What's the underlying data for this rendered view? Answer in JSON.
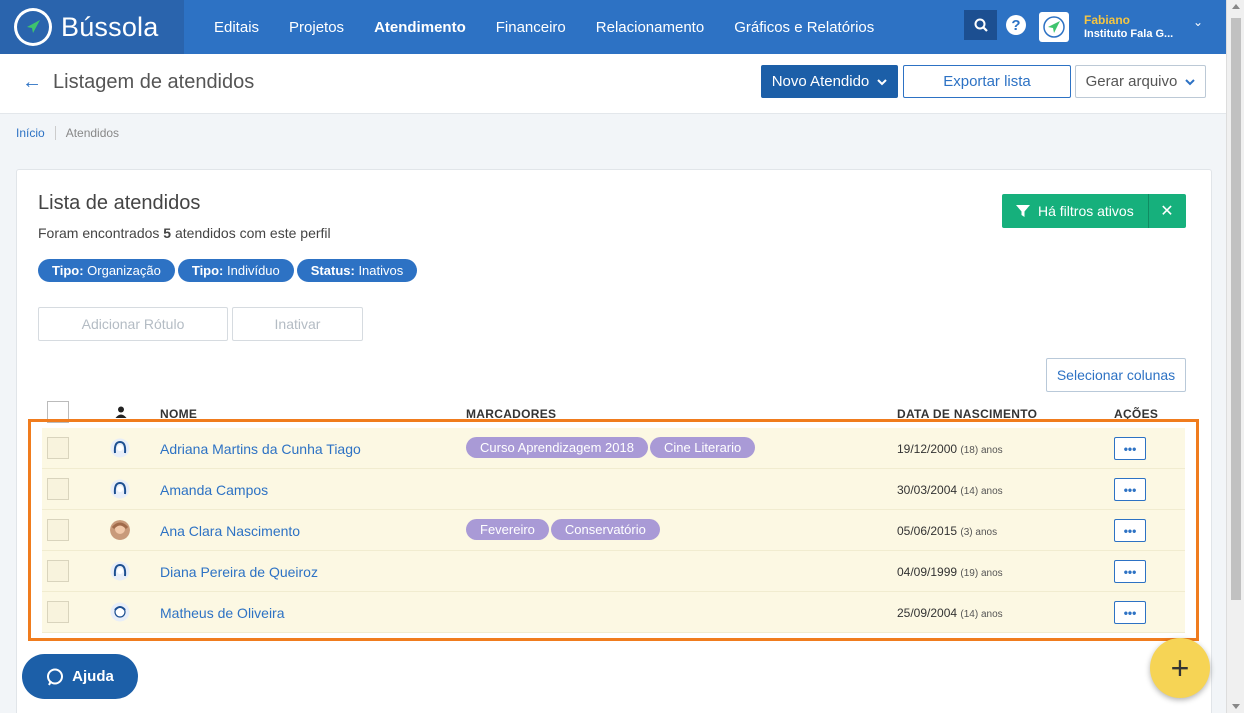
{
  "brand": {
    "name": "Bússola"
  },
  "nav": {
    "items": [
      {
        "label": "Editais"
      },
      {
        "label": "Projetos"
      },
      {
        "label": "Atendimento"
      },
      {
        "label": "Financeiro"
      },
      {
        "label": "Relacionamento"
      },
      {
        "label": "Gráficos e Relatórios"
      }
    ],
    "active": "Atendimento"
  },
  "user": {
    "name": "Fabiano",
    "org": "Instituto Fala G..."
  },
  "header": {
    "title": "Listagem de atendidos",
    "novo_label": "Novo Atendido",
    "export_label": "Exportar lista",
    "gerar_label": "Gerar arquivo"
  },
  "breadcrumb": {
    "home": "Início",
    "current": "Atendidos"
  },
  "card": {
    "title": "Lista de atendidos",
    "sub_prefix": "Foram encontrados ",
    "count": "5",
    "sub_suffix": " atendidos com este perfil",
    "filters_label": "Há filtros ativos",
    "chips": [
      {
        "key": "Tipo:",
        "value": " Organização"
      },
      {
        "key": "Tipo:",
        "value": " Indivíduo"
      },
      {
        "key": "Status:",
        "value": " Inativos"
      }
    ],
    "add_label": "Adicionar Rótulo",
    "inativar_label": "Inativar",
    "select_cols_label": "Selecionar colunas"
  },
  "table": {
    "headers": {
      "name": "NOME",
      "markers": "MARCADORES",
      "birth": "DATA DE NASCIMENTO",
      "actions": "AÇÕES"
    },
    "rows": [
      {
        "name": "Adriana Martins da Cunha Tiago",
        "tags": [
          "Curso Aprendizagem 2018",
          "Cine Literario"
        ],
        "date": "19/12/2000",
        "age": "(18) anos",
        "avatar": "female-icon"
      },
      {
        "name": "Amanda Campos",
        "tags": [],
        "date": "30/03/2004",
        "age": "(14) anos",
        "avatar": "female-icon"
      },
      {
        "name": "Ana Clara Nascimento",
        "tags": [
          "Fevereiro",
          "Conservatório"
        ],
        "date": "05/06/2015",
        "age": "(3) anos",
        "avatar": "photo"
      },
      {
        "name": "Diana Pereira de Queiroz",
        "tags": [],
        "date": "04/09/1999",
        "age": "(19) anos",
        "avatar": "female-icon"
      },
      {
        "name": "Matheus de Oliveira",
        "tags": [],
        "date": "25/09/2004",
        "age": "(14) anos",
        "avatar": "male-icon"
      }
    ]
  },
  "help": {
    "label": "Ajuda"
  },
  "colors": {
    "primary": "#2d72c4",
    "success": "#16b07c",
    "tag": "#a99ad6",
    "highlight": "#f07c1e",
    "fab": "#f6d455"
  }
}
